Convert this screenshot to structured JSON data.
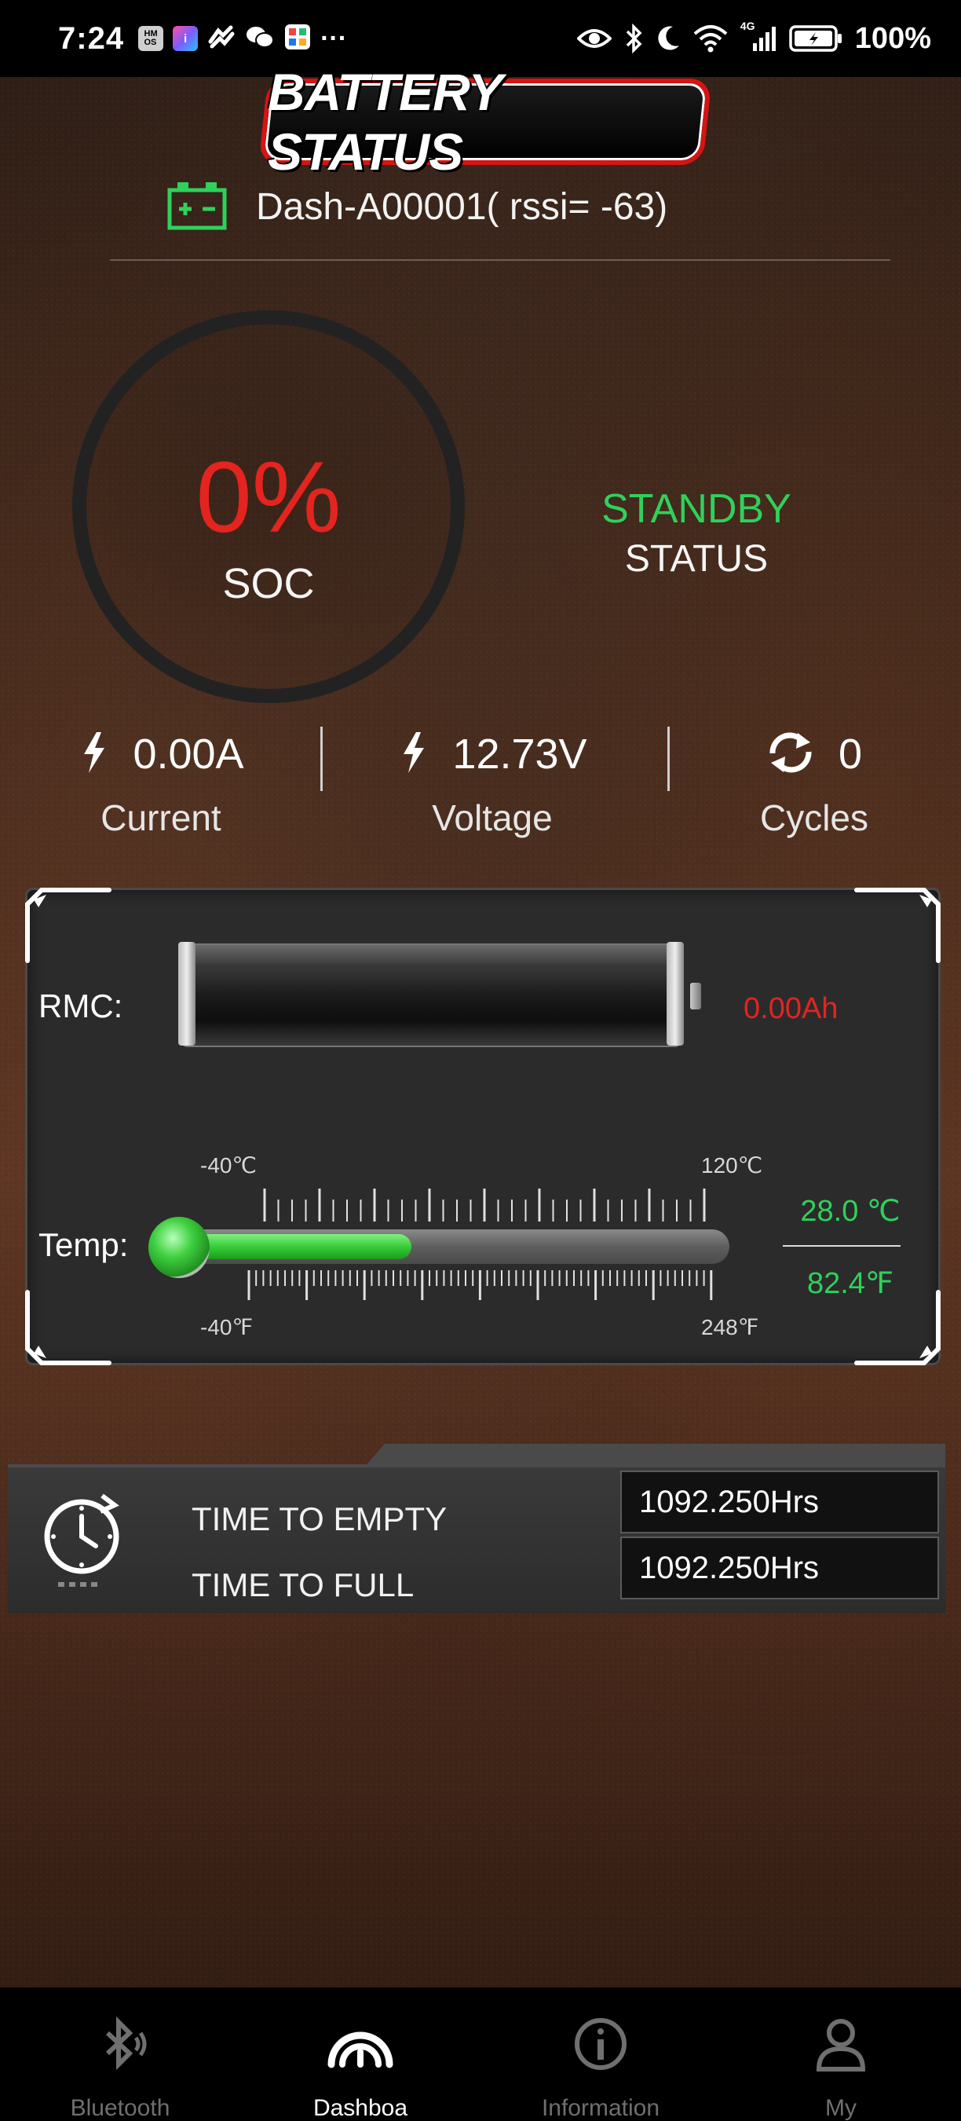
{
  "status_bar": {
    "time": "7:24",
    "notification_icons": [
      "hmos-icon",
      "app-icon",
      "link-icon",
      "wechat-icon",
      "grid-app-icon",
      "more-icon"
    ],
    "right_icons": [
      "eye-icon",
      "bluetooth-icon",
      "moon-icon",
      "wifi-icon",
      "signal-4g-icon",
      "battery-icon"
    ],
    "signal_label": "4G",
    "battery_percent": "100%"
  },
  "header": {
    "title": "BATTERY STATUS",
    "device_name": "Dash-A00001( rssi= -63)",
    "device_icon": "battery-device-icon",
    "accent_color": "#2fd15b"
  },
  "soc": {
    "value": "0%",
    "label": "SOC",
    "value_color": "#e3241f"
  },
  "state": {
    "value": "STANDBY",
    "label": "STATUS"
  },
  "metrics": [
    {
      "icon": "lightning-icon",
      "value": "0.00A",
      "label": "Current"
    },
    {
      "icon": "lightning-icon",
      "value": "12.73V",
      "label": "Voltage"
    },
    {
      "icon": "refresh-icon",
      "value": "0",
      "label": "Cycles"
    }
  ],
  "rmc": {
    "label": "RMC:",
    "value": "0.00Ah",
    "fill_fraction": 0.0
  },
  "temperature": {
    "label": "Temp:",
    "scale_c_min": "-40℃",
    "scale_c_max": "120℃",
    "scale_f_min": "-40℉",
    "scale_f_max": "248℉",
    "celsius": "28.0 ℃",
    "fahrenheit": "82.4℉",
    "value_c": 28.0,
    "range_c": [
      -40,
      120
    ]
  },
  "time_panel": {
    "icon": "clock-icon",
    "empty_label": "TIME TO EMPTY",
    "empty_value": "1092.250Hrs",
    "full_label": "TIME TO FULL",
    "full_value": "1092.250Hrs"
  },
  "nav": {
    "items": [
      {
        "label": "Bluetooth",
        "icon": "bluetooth-icon",
        "active": false
      },
      {
        "label": "Dashboa",
        "icon": "dashboard-icon",
        "active": true
      },
      {
        "label": "Information",
        "icon": "info-icon",
        "active": false
      },
      {
        "label": "My",
        "icon": "user-icon",
        "active": false
      }
    ]
  }
}
